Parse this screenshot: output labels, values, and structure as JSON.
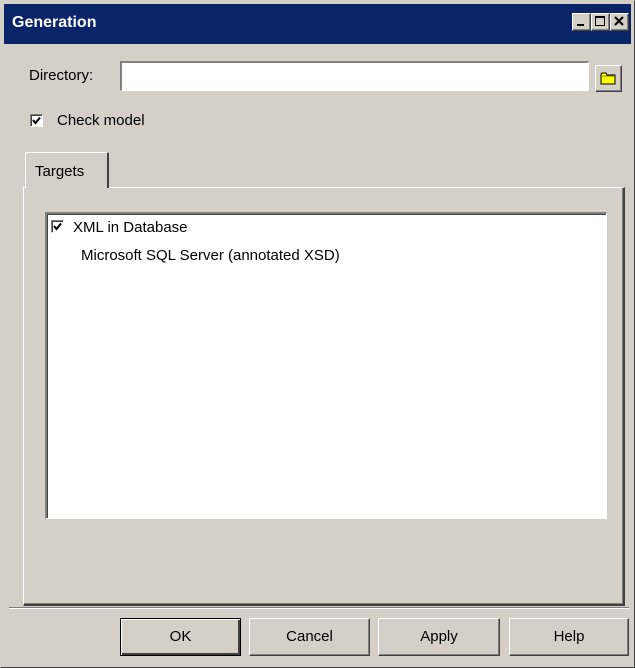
{
  "window": {
    "title": "Generation",
    "controls": [
      "minimize-icon",
      "maximize-icon",
      "close-icon"
    ]
  },
  "directory": {
    "label": "Directory:",
    "value": "",
    "placeholder": "",
    "browse_icon": "folder-icon"
  },
  "check_model": {
    "label": "Check model",
    "checked": true
  },
  "tabs": [
    {
      "label": "Targets",
      "active": true
    }
  ],
  "targets_tree": {
    "items": [
      {
        "label": "XML in Database",
        "checked": true,
        "children": [
          {
            "label": "Microsoft SQL Server (annotated XSD)"
          }
        ]
      }
    ]
  },
  "buttons": {
    "ok": "OK",
    "cancel": "Cancel",
    "apply": "Apply",
    "help": "Help"
  },
  "colors": {
    "titlebar": "#0a246a",
    "face": "#d4d0c8",
    "folder": "#ffff00"
  }
}
